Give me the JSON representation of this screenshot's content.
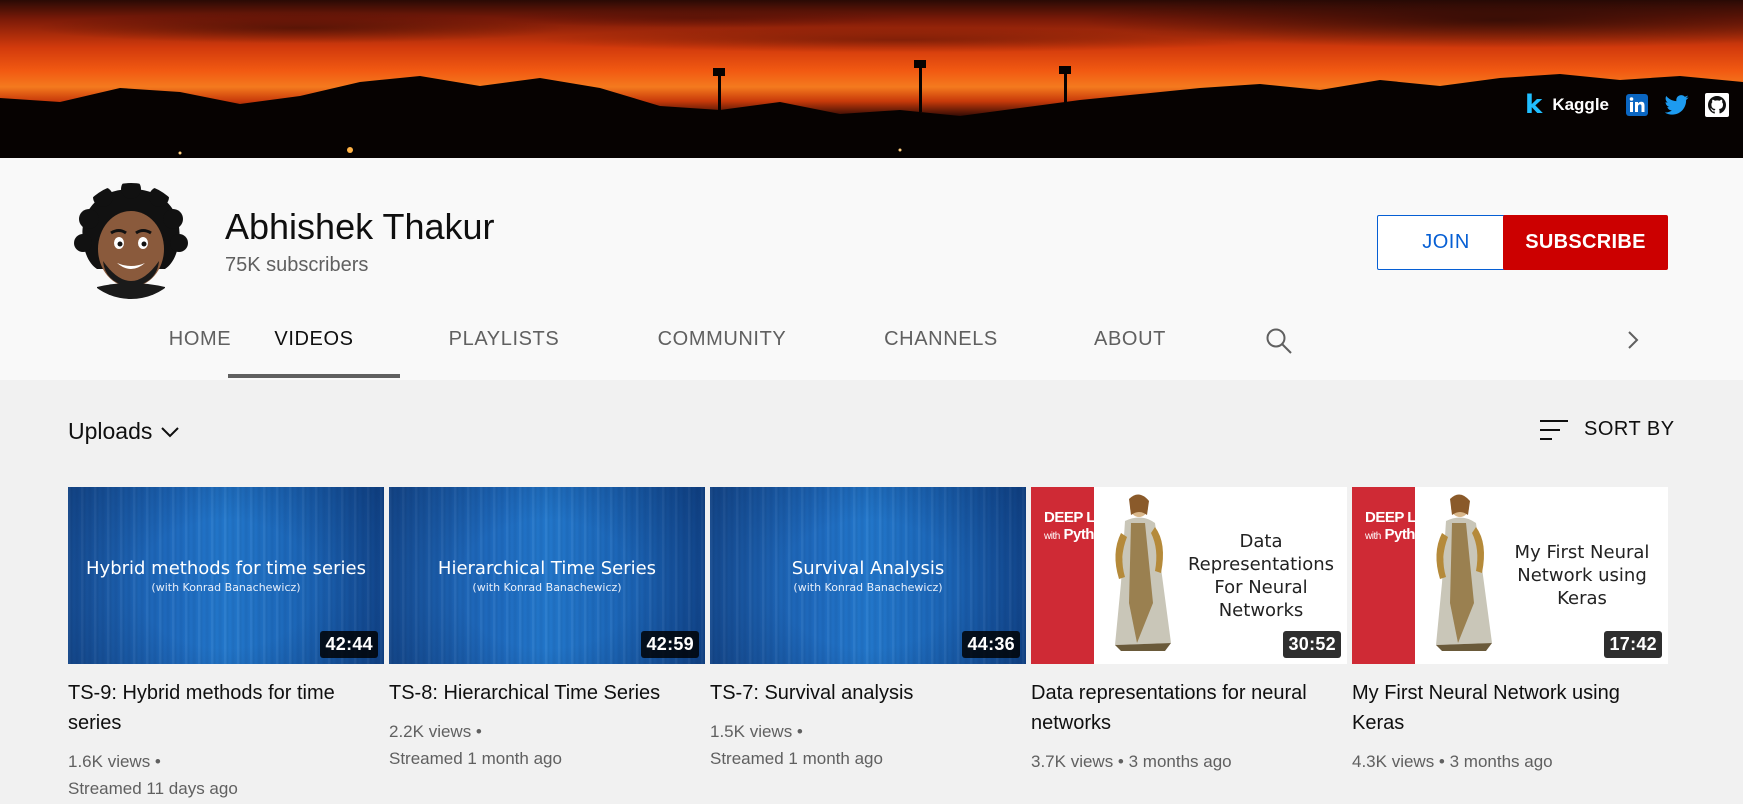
{
  "banner": {
    "kaggle_label": "Kaggle",
    "kaggle_mark": "k",
    "links": [
      "linkedin-icon",
      "twitter-icon",
      "github-icon"
    ]
  },
  "channel": {
    "name": "Abhishek Thakur",
    "subscribers": "75K subscribers",
    "join_label": "JOIN",
    "subscribe_label": "SUBSCRIBE"
  },
  "tabs": [
    {
      "label": "HOME",
      "active": false
    },
    {
      "label": "VIDEOS",
      "active": true
    },
    {
      "label": "PLAYLISTS",
      "active": false
    },
    {
      "label": "COMMUNITY",
      "active": false
    },
    {
      "label": "CHANNELS",
      "active": false
    },
    {
      "label": "ABOUT",
      "active": false
    }
  ],
  "content": {
    "section_label": "Uploads",
    "sort_label": "SORT BY"
  },
  "videos": [
    {
      "thumb_style": "blue",
      "thumb_title": "Hybrid methods for time series",
      "thumb_sub": "(with Konrad Banachewicz)",
      "duration": "42:44",
      "title": "TS-9: Hybrid methods for time series",
      "views": "1.6K views",
      "age": "Streamed 11 days ago"
    },
    {
      "thumb_style": "blue",
      "thumb_title": "Hierarchical Time Series",
      "thumb_sub": "(with Konrad Banachewicz)",
      "duration": "42:59",
      "title": "TS-8: Hierarchical Time Series",
      "views": "2.2K views",
      "age": "Streamed 1 month ago"
    },
    {
      "thumb_style": "blue",
      "thumb_title": "Survival Analysis",
      "thumb_sub": "(with Konrad Banachewicz)",
      "duration": "44:36",
      "title": "TS-7: Survival analysis",
      "views": "1.5K views",
      "age": "Streamed 1 month ago"
    },
    {
      "thumb_style": "book",
      "book_title_line1": "DEEP LEARNING",
      "book_title_line2_small": "with",
      "book_title_line2": "Python",
      "thumb_text": "Data Representations For Neural Networks",
      "duration": "30:52",
      "title": "Data representations for neural networks",
      "views": "3.7K views",
      "age": "3 months ago"
    },
    {
      "thumb_style": "book",
      "book_title_line1": "DEEP LEARNING",
      "book_title_line2_small": "with",
      "book_title_line2": "Python",
      "thumb_text": "My First Neural Network using Keras",
      "duration": "17:42",
      "title": "My First Neural Network using Keras",
      "views": "4.3K views",
      "age": "3 months ago"
    }
  ],
  "colors": {
    "subscribe": "#cc0000",
    "join": "#065fd4",
    "kaggle": "#20beff",
    "linkedin": "#0a66c2",
    "twitter": "#1d9bf0"
  }
}
